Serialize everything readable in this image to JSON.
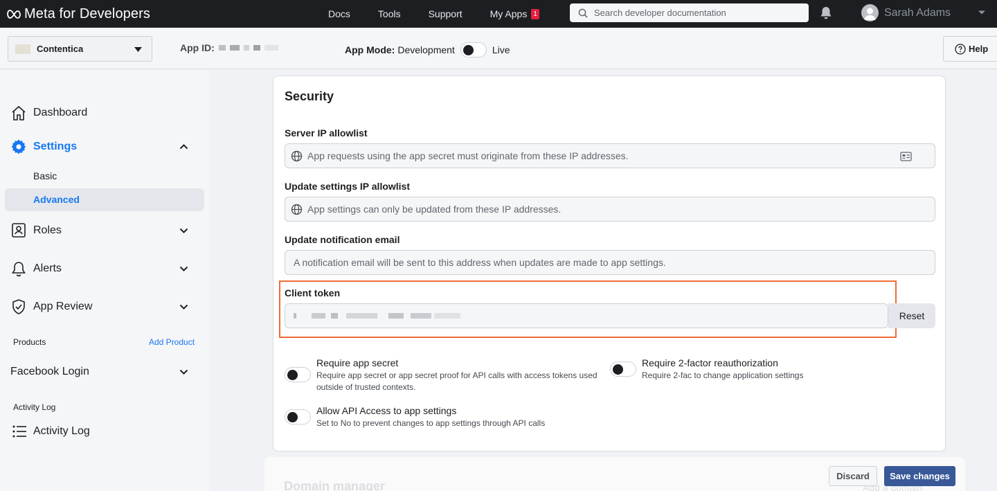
{
  "topnav": {
    "brand": "Meta for Developers",
    "links": [
      {
        "label": "Docs"
      },
      {
        "label": "Tools"
      },
      {
        "label": "Support"
      },
      {
        "label": "My Apps",
        "badge": "1"
      }
    ],
    "search_placeholder": "Search developer documentation",
    "user_name": "Sarah Adams"
  },
  "subheader": {
    "app_name": "Contentica",
    "app_id_label": "App ID:",
    "app_mode_label": "App Mode:",
    "app_mode_value": "Development",
    "app_mode_alt": "Live",
    "help_label": "Help"
  },
  "sidebar": {
    "dashboard": "Dashboard",
    "settings": "Settings",
    "settings_basic": "Basic",
    "settings_advanced": "Advanced",
    "roles": "Roles",
    "alerts": "Alerts",
    "app_review": "App Review",
    "products_label": "Products",
    "add_product": "Add Product",
    "facebook_login": "Facebook Login",
    "activity_log_label": "Activity Log",
    "activity_log": "Activity Log"
  },
  "security": {
    "title": "Security",
    "server_ip_label": "Server IP allowlist",
    "server_ip_placeholder": "App requests using the app secret must originate from these IP addresses.",
    "update_ip_label": "Update settings IP allowlist",
    "update_ip_placeholder": "App settings can only be updated from these IP addresses.",
    "notif_email_label": "Update notification email",
    "notif_email_placeholder": "A notification email will be sent to this address when updates are made to app settings.",
    "client_token_label": "Client token",
    "reset_label": "Reset",
    "toggles": [
      {
        "title": "Require app secret",
        "desc": "Require app secret or app secret proof for API calls with access tokens used outside of trusted contexts.",
        "on": false
      },
      {
        "title": "Require 2-factor reauthorization",
        "desc": "Require 2-fac to change application settings",
        "on": false
      },
      {
        "title": "Allow API Access to app settings",
        "desc": "Set to No to prevent changes to app settings through API calls",
        "on": false
      }
    ]
  },
  "domain_manager": {
    "title": "Domain manager",
    "add_domain": "Add a domain"
  },
  "footer": {
    "discard": "Discard",
    "save": "Save changes"
  },
  "colors": {
    "accent": "#1877f2",
    "highlight_border": "#f06a35",
    "save_button": "#385898",
    "nav_bg": "#1c1e21"
  }
}
